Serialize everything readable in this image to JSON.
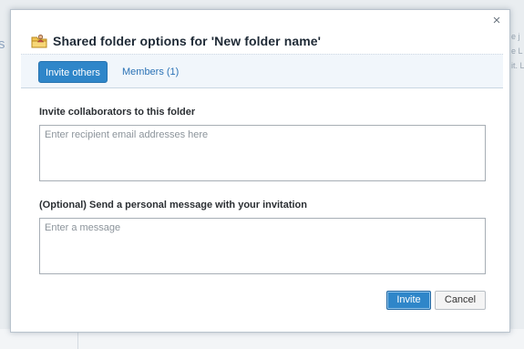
{
  "background": {
    "left_glyph": "s",
    "right_lines": [
      "e j",
      "e L",
      "it. L"
    ]
  },
  "dialog": {
    "title": "Shared folder options for 'New folder name'",
    "close_glyph": "×",
    "tabs": [
      {
        "label": "Invite others",
        "active": true
      },
      {
        "label": "Members (1)",
        "active": false
      }
    ],
    "invite_label": "Invite collaborators to this folder",
    "invite_placeholder": "Enter recipient email addresses here",
    "message_label": "(Optional) Send a personal message with your invitation",
    "message_placeholder": "Enter a message",
    "invite_button": "Invite",
    "cancel_button": "Cancel",
    "icons": {
      "title": "shared-folder-icon",
      "close": "close-icon"
    },
    "colors": {
      "accent": "#2f86c9",
      "tab_bar": "#f1f6fb",
      "link": "#2c73b6"
    }
  }
}
